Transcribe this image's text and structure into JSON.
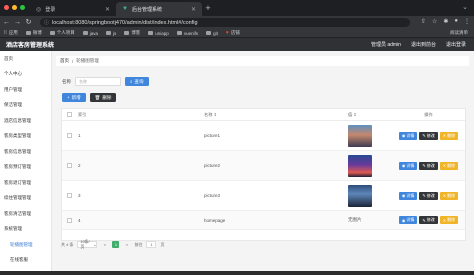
{
  "browser": {
    "tabs": [
      {
        "title": "登录",
        "active": false
      },
      {
        "title": "后台管理系统",
        "active": true
      }
    ],
    "url": "localhost:8080/springbootj470/admin/dist/index.html#/config",
    "bookmarks": [
      "应用",
      "微博",
      "个人项目",
      "java",
      "js",
      "博客",
      "uniapp",
      "vuenifs",
      "git",
      "店铺"
    ],
    "bookmarks_right": "阅读清单"
  },
  "app": {
    "title": "酒店客房管理系统",
    "header_right": [
      "管理员 admin",
      "退出到前台",
      "退出登录"
    ]
  },
  "sidebar": {
    "items": [
      {
        "label": "首页",
        "active": false,
        "sub": false
      },
      {
        "label": "个人中心",
        "active": false,
        "sub": false
      },
      {
        "label": "用户管理",
        "active": false,
        "sub": false
      },
      {
        "label": "保洁管理",
        "active": false,
        "sub": false
      },
      {
        "label": "酒店信息管理",
        "active": false,
        "sub": false
      },
      {
        "label": "客房类型管理",
        "active": false,
        "sub": false
      },
      {
        "label": "客房信息管理",
        "active": false,
        "sub": false
      },
      {
        "label": "客房预订管理",
        "active": false,
        "sub": false
      },
      {
        "label": "客房退订管理",
        "active": false,
        "sub": false
      },
      {
        "label": "续住管理管理",
        "active": false,
        "sub": false
      },
      {
        "label": "客房清洁管理",
        "active": false,
        "sub": false
      },
      {
        "label": "系统管理",
        "active": false,
        "sub": false
      },
      {
        "label": "轮播图管理",
        "active": true,
        "sub": true
      },
      {
        "label": "在线客服",
        "active": false,
        "sub": true
      }
    ]
  },
  "breadcrumb": {
    "home": "首页",
    "current": "轮播图管理"
  },
  "search": {
    "label": "名称",
    "placeholder": "名称",
    "button": "查询"
  },
  "actions": {
    "add": "新增",
    "delete": "删除"
  },
  "table": {
    "headers": {
      "index": "索引",
      "name": "名称",
      "value": "值",
      "action": "操作"
    },
    "rows": [
      {
        "index": "1",
        "name": "picture1",
        "value": "",
        "thumb": "thumb1"
      },
      {
        "index": "2",
        "name": "picture2",
        "value": "",
        "thumb": "thumb2"
      },
      {
        "index": "3",
        "name": "picture3",
        "value": "",
        "thumb": "thumb3"
      },
      {
        "index": "4",
        "name": "homepage",
        "value": "无图片",
        "thumb": ""
      }
    ],
    "row_buttons": {
      "detail": "详情",
      "edit": "修改",
      "delete": "删除"
    }
  },
  "pagination": {
    "total": "共 4 条",
    "page_size": "10条/页",
    "prev": "<",
    "current": "1",
    "next": ">",
    "goto_label": "前往",
    "goto_value": "1",
    "page_suffix": "页"
  }
}
